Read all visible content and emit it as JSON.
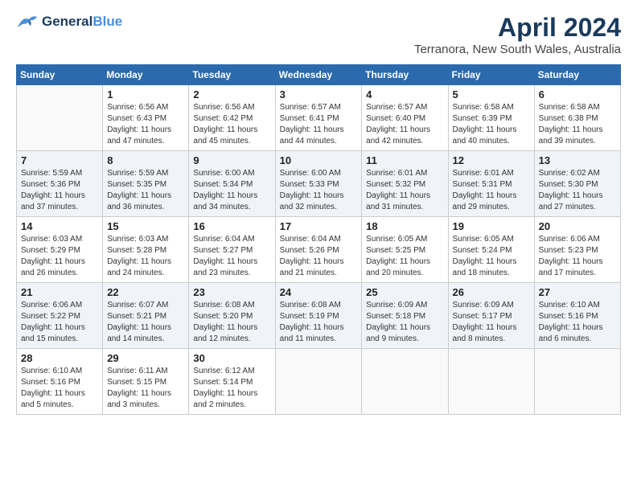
{
  "logo": {
    "line1": "General",
    "line2": "Blue"
  },
  "title": "April 2024",
  "location": "Terranora, New South Wales, Australia",
  "weekdays": [
    "Sunday",
    "Monday",
    "Tuesday",
    "Wednesday",
    "Thursday",
    "Friday",
    "Saturday"
  ],
  "weeks": [
    [
      {
        "day": "",
        "info": ""
      },
      {
        "day": "1",
        "info": "Sunrise: 6:56 AM\nSunset: 6:43 PM\nDaylight: 11 hours\nand 47 minutes."
      },
      {
        "day": "2",
        "info": "Sunrise: 6:56 AM\nSunset: 6:42 PM\nDaylight: 11 hours\nand 45 minutes."
      },
      {
        "day": "3",
        "info": "Sunrise: 6:57 AM\nSunset: 6:41 PM\nDaylight: 11 hours\nand 44 minutes."
      },
      {
        "day": "4",
        "info": "Sunrise: 6:57 AM\nSunset: 6:40 PM\nDaylight: 11 hours\nand 42 minutes."
      },
      {
        "day": "5",
        "info": "Sunrise: 6:58 AM\nSunset: 6:39 PM\nDaylight: 11 hours\nand 40 minutes."
      },
      {
        "day": "6",
        "info": "Sunrise: 6:58 AM\nSunset: 6:38 PM\nDaylight: 11 hours\nand 39 minutes."
      }
    ],
    [
      {
        "day": "7",
        "info": "Sunrise: 5:59 AM\nSunset: 5:36 PM\nDaylight: 11 hours\nand 37 minutes."
      },
      {
        "day": "8",
        "info": "Sunrise: 5:59 AM\nSunset: 5:35 PM\nDaylight: 11 hours\nand 36 minutes."
      },
      {
        "day": "9",
        "info": "Sunrise: 6:00 AM\nSunset: 5:34 PM\nDaylight: 11 hours\nand 34 minutes."
      },
      {
        "day": "10",
        "info": "Sunrise: 6:00 AM\nSunset: 5:33 PM\nDaylight: 11 hours\nand 32 minutes."
      },
      {
        "day": "11",
        "info": "Sunrise: 6:01 AM\nSunset: 5:32 PM\nDaylight: 11 hours\nand 31 minutes."
      },
      {
        "day": "12",
        "info": "Sunrise: 6:01 AM\nSunset: 5:31 PM\nDaylight: 11 hours\nand 29 minutes."
      },
      {
        "day": "13",
        "info": "Sunrise: 6:02 AM\nSunset: 5:30 PM\nDaylight: 11 hours\nand 27 minutes."
      }
    ],
    [
      {
        "day": "14",
        "info": "Sunrise: 6:03 AM\nSunset: 5:29 PM\nDaylight: 11 hours\nand 26 minutes."
      },
      {
        "day": "15",
        "info": "Sunrise: 6:03 AM\nSunset: 5:28 PM\nDaylight: 11 hours\nand 24 minutes."
      },
      {
        "day": "16",
        "info": "Sunrise: 6:04 AM\nSunset: 5:27 PM\nDaylight: 11 hours\nand 23 minutes."
      },
      {
        "day": "17",
        "info": "Sunrise: 6:04 AM\nSunset: 5:26 PM\nDaylight: 11 hours\nand 21 minutes."
      },
      {
        "day": "18",
        "info": "Sunrise: 6:05 AM\nSunset: 5:25 PM\nDaylight: 11 hours\nand 20 minutes."
      },
      {
        "day": "19",
        "info": "Sunrise: 6:05 AM\nSunset: 5:24 PM\nDaylight: 11 hours\nand 18 minutes."
      },
      {
        "day": "20",
        "info": "Sunrise: 6:06 AM\nSunset: 5:23 PM\nDaylight: 11 hours\nand 17 minutes."
      }
    ],
    [
      {
        "day": "21",
        "info": "Sunrise: 6:06 AM\nSunset: 5:22 PM\nDaylight: 11 hours\nand 15 minutes."
      },
      {
        "day": "22",
        "info": "Sunrise: 6:07 AM\nSunset: 5:21 PM\nDaylight: 11 hours\nand 14 minutes."
      },
      {
        "day": "23",
        "info": "Sunrise: 6:08 AM\nSunset: 5:20 PM\nDaylight: 11 hours\nand 12 minutes."
      },
      {
        "day": "24",
        "info": "Sunrise: 6:08 AM\nSunset: 5:19 PM\nDaylight: 11 hours\nand 11 minutes."
      },
      {
        "day": "25",
        "info": "Sunrise: 6:09 AM\nSunset: 5:18 PM\nDaylight: 11 hours\nand 9 minutes."
      },
      {
        "day": "26",
        "info": "Sunrise: 6:09 AM\nSunset: 5:17 PM\nDaylight: 11 hours\nand 8 minutes."
      },
      {
        "day": "27",
        "info": "Sunrise: 6:10 AM\nSunset: 5:16 PM\nDaylight: 11 hours\nand 6 minutes."
      }
    ],
    [
      {
        "day": "28",
        "info": "Sunrise: 6:10 AM\nSunset: 5:16 PM\nDaylight: 11 hours\nand 5 minutes."
      },
      {
        "day": "29",
        "info": "Sunrise: 6:11 AM\nSunset: 5:15 PM\nDaylight: 11 hours\nand 3 minutes."
      },
      {
        "day": "30",
        "info": "Sunrise: 6:12 AM\nSunset: 5:14 PM\nDaylight: 11 hours\nand 2 minutes."
      },
      {
        "day": "",
        "info": ""
      },
      {
        "day": "",
        "info": ""
      },
      {
        "day": "",
        "info": ""
      },
      {
        "day": "",
        "info": ""
      }
    ]
  ]
}
